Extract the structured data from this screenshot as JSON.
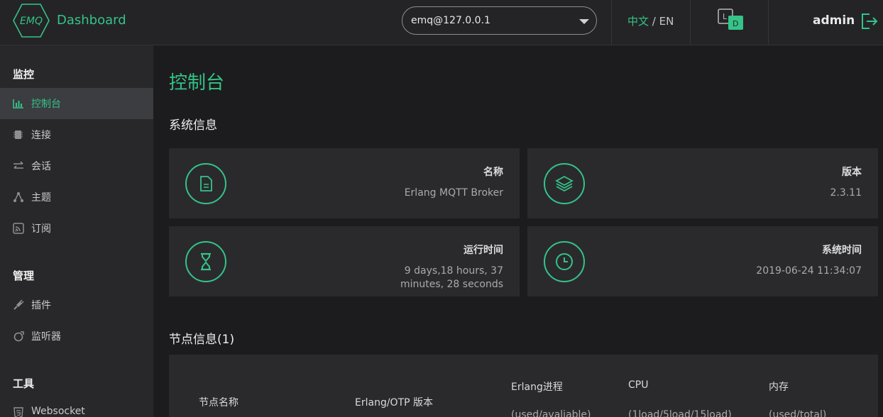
{
  "header": {
    "brand_logo_text": "EMQ",
    "brand": "Dashboard",
    "node": "emq@127.0.0.1",
    "lang_zh": "中文",
    "lang_sep": "/",
    "lang_en": "EN",
    "theme_light": "L",
    "theme_dark": "D",
    "user": "admin"
  },
  "sidebar": {
    "groups": [
      {
        "title": "监控",
        "items": [
          {
            "label": "控制台",
            "icon": "bar-chart-icon",
            "active": true
          },
          {
            "label": "连接",
            "icon": "chip-icon"
          },
          {
            "label": "会话",
            "icon": "swap-icon"
          },
          {
            "label": "主题",
            "icon": "topic-icon"
          },
          {
            "label": "订阅",
            "icon": "rss-icon"
          }
        ]
      },
      {
        "title": "管理",
        "items": [
          {
            "label": "插件",
            "icon": "plug-icon"
          },
          {
            "label": "监听器",
            "icon": "listener-icon"
          }
        ]
      },
      {
        "title": "工具",
        "items": [
          {
            "label": "Websocket",
            "icon": "html5-icon"
          }
        ]
      }
    ]
  },
  "main": {
    "title": "控制台",
    "system_info_title": "系统信息",
    "cards": [
      {
        "label": "名称",
        "value": "Erlang MQTT Broker",
        "icon": "file-icon"
      },
      {
        "label": "版本",
        "value": "2.3.11",
        "icon": "layers-icon"
      },
      {
        "label": "运行时间",
        "value": "9 days,18 hours, 37 minutes, 28 seconds",
        "icon": "hourglass-icon"
      },
      {
        "label": "系统时间",
        "value": "2019-06-24 11:34:07",
        "icon": "clock-icon"
      }
    ],
    "node_info_title": "节点信息(1)",
    "table_headers": [
      {
        "label": "节点名称",
        "sub": ""
      },
      {
        "label": "Erlang/OTP 版本",
        "sub": ""
      },
      {
        "label": "Erlang进程",
        "sub": "(used/avaliable)"
      },
      {
        "label": "CPU",
        "sub": "(1load/5load/15load)"
      },
      {
        "label": "内存",
        "sub": "(used/total)"
      }
    ]
  },
  "colors": {
    "accent": "#34c388",
    "bg": "#1c1c1e",
    "panel": "#2a2a2d"
  }
}
